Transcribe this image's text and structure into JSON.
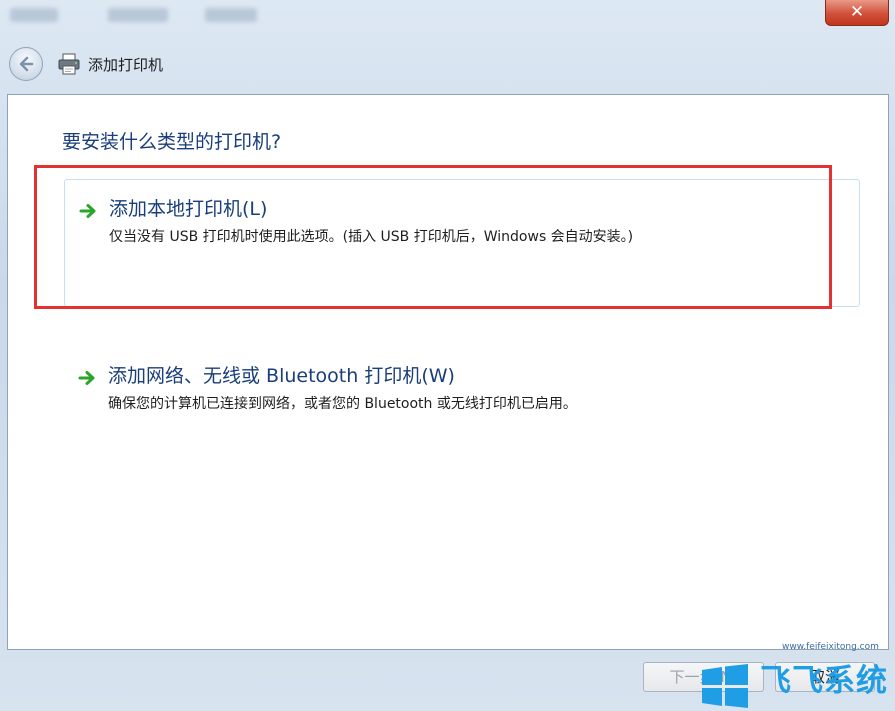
{
  "window": {
    "title": "添加打印机",
    "close_symbol": "✕"
  },
  "main": {
    "question": "要安装什么类型的打印机?",
    "options": [
      {
        "label": "添加本地打印机(L)",
        "description": "仅当没有 USB 打印机时使用此选项。(插入 USB 打印机后，Windows 会自动安装。)",
        "icon": "green-arrow-icon",
        "highlighted": true
      },
      {
        "label": "添加网络、无线或 Bluetooth 打印机(W)",
        "description": "确保您的计算机已连接到网络，或者您的 Bluetooth 或无线打印机已启用。",
        "icon": "green-arrow-icon",
        "highlighted": false
      }
    ]
  },
  "footer": {
    "next_label": "下一步(N)",
    "next_enabled": false,
    "cancel_label": "取消"
  },
  "watermark": {
    "text": "飞飞系统",
    "url": "www.feifeixitong.com"
  },
  "colors": {
    "accent_text": "#1a3e7a",
    "highlight_border": "#e23232",
    "arrow_green": "#2aa52a",
    "close_red": "#c0371f",
    "watermark_blue": "#1f9ee6"
  }
}
